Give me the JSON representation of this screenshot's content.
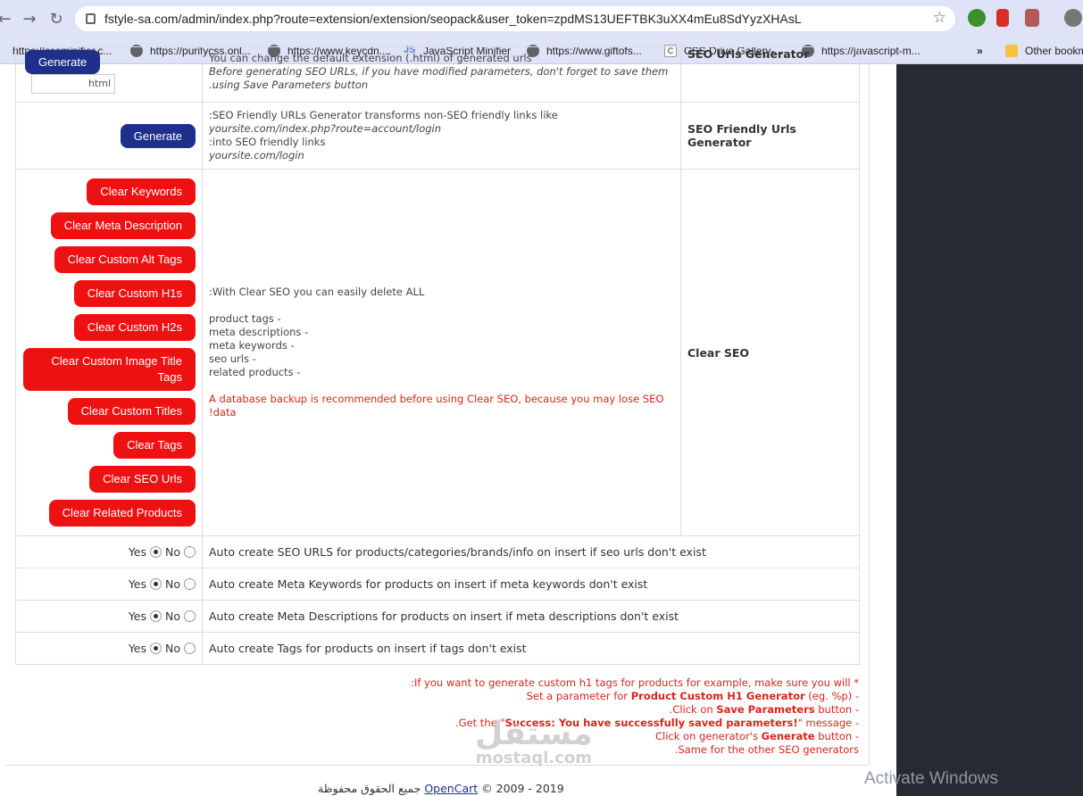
{
  "browser": {
    "url": "fstyle-sa.com/admin/index.php?route=extension/extension/seopack&user_token=zpdMS13UEFTBK3uXX4mEu8SdYyzXHAsL",
    "bookmarks": [
      {
        "label": "https://cssminifier.c...",
        "icon": "globe-icon"
      },
      {
        "label": "https://purifycss.onl...",
        "icon": "globe-icon"
      },
      {
        "label": "https://www.keycdn....",
        "icon": "globe-icon"
      },
      {
        "label": "JavaScript Minifier",
        "icon": "js-icon"
      },
      {
        "label": "https://www.giftofs...",
        "icon": "globe-icon"
      },
      {
        "label": "CSS Drive Gallery-...",
        "icon": "c-icon"
      },
      {
        "label": "https://javascript-m...",
        "icon": "globe-icon"
      }
    ],
    "more": "»",
    "other_bookmarks": "Other bookm"
  },
  "seo_urls_generator": {
    "button": "Generate",
    "input_value": "html",
    "desc_line1": "You can change the default extension (.html) of generated urls",
    "desc_line2": "Before generating SEO URLs, if you have modified parameters, don't forget to save them",
    "desc_line3": ".using Save Parameters button",
    "title": "SEO Urls Generator"
  },
  "friendly_urls_generator": {
    "button": "Generate",
    "desc_line1": ":SEO Friendly URLs Generator transforms non-SEO friendly links like",
    "desc_line2": "yoursite.com/index.php?route=account/login",
    "desc_line3": ":into SEO friendly links",
    "desc_line4": "yoursite.com/login",
    "title": "SEO Friendly Urls Generator"
  },
  "clear_seo": {
    "title": "Clear SEO",
    "buttons": [
      "Clear Keywords",
      "Clear Meta Description",
      "Clear Custom Alt Tags",
      "Clear Custom H1s",
      "Clear Custom H2s",
      "Clear Custom Image Title Tags",
      "Clear Custom Titles",
      "Clear Tags",
      "Clear SEO Urls",
      "Clear Related Products"
    ],
    "intro": ":With Clear SEO you can easily delete ALL",
    "items": [
      "product tags -",
      "meta descriptions -",
      "meta keywords -",
      "seo urls -",
      "related products -"
    ],
    "warning_line1": "A database backup is recommended before using Clear SEO, because you may lose SEO",
    "warning_line2": "!data"
  },
  "auto_options": {
    "yes_label": "Yes",
    "no_label": "No",
    "rows": [
      {
        "label": "Auto create SEO URLS for products/categories/brands/info on insert if seo urls don't exist",
        "selected": "yes"
      },
      {
        "label": "Auto create Meta Keywords for products on insert if meta keywords don't exist",
        "selected": "yes"
      },
      {
        "label": "Auto create Meta Descriptions for products on insert if meta descriptions don't exist",
        "selected": "yes"
      },
      {
        "label": "Auto create Tags for products on insert if tags don't exist",
        "selected": "yes"
      }
    ]
  },
  "notes": {
    "line1": ":If you want to generate custom h1 tags for products for example, make sure you will *",
    "line2_pre": "Set a parameter for ",
    "line2_bold": "Product Custom H1 Generator",
    "line2_post": " (eg. %p) -",
    "line3_pre": ".Click on ",
    "line3_bold": "Save Parameters",
    "line3_post": " button -",
    "line4_pre": ".Get the \"",
    "line4_bold": "Success: You have successfully saved parameters!",
    "line4_post": "\" message -",
    "line5_pre": "Click on generator's ",
    "line5_bold": "Generate",
    "line5_post": " button -",
    "line6": ".Same for the other SEO generators"
  },
  "footer": {
    "arabic": "جميع الحقوق محفوظة",
    "link": "OpenCart",
    "years": "© 2009 - 2019"
  },
  "watermark": {
    "arabic": "مستقل",
    "latin": "mostaql.com"
  },
  "os_overlay": "Activate Windows"
}
